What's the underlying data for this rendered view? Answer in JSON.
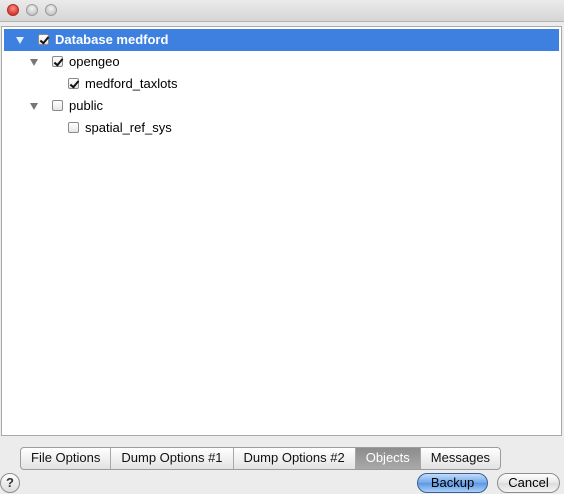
{
  "window": {
    "controls": [
      "close",
      "minimize",
      "zoom"
    ]
  },
  "tree": [
    {
      "label": "Database medford",
      "checked": true,
      "expanded": true,
      "selected": true
    },
    {
      "label": "opengeo",
      "checked": true,
      "expanded": true,
      "selected": false
    },
    {
      "label": "medford_taxlots",
      "checked": true,
      "selected": false
    },
    {
      "label": "public",
      "checked": false,
      "expanded": true,
      "selected": false
    },
    {
      "label": "spatial_ref_sys",
      "checked": false,
      "selected": false
    }
  ],
  "tabs": [
    {
      "label": "File Options",
      "active": false
    },
    {
      "label": "Dump Options #1",
      "active": false
    },
    {
      "label": "Dump Options #2",
      "active": false
    },
    {
      "label": "Objects",
      "active": true
    },
    {
      "label": "Messages",
      "active": false
    }
  ],
  "footer": {
    "help_label": "?",
    "backup_label": "Backup",
    "cancel_label": "Cancel"
  },
  "colors": {
    "selection": "#3d80df",
    "active_tab": "#999999"
  }
}
